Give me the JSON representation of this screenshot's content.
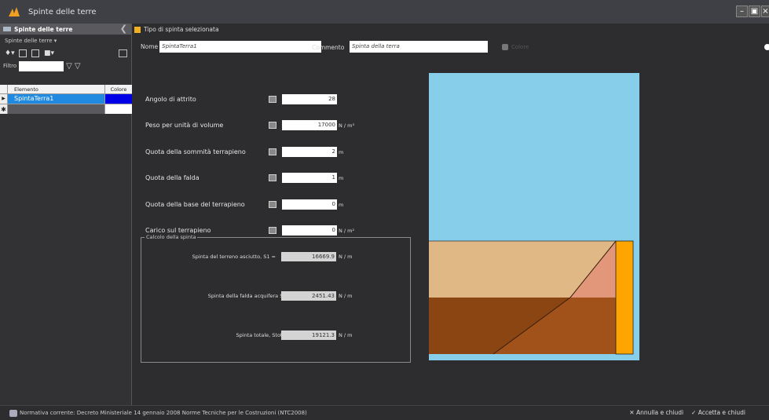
{
  "window": {
    "title": "Spinte delle terre"
  },
  "left_panel": {
    "header": "Spinte delle terre",
    "menu_label": "Spinte delle terre ▾",
    "filter_label": "Filtro",
    "grid": {
      "columns": [
        "Elemento",
        "Colore"
      ],
      "rows": [
        {
          "selected_marker": "▶",
          "elemento": "SpintaTerra1",
          "colore": "#0000e6"
        }
      ],
      "new_row_marker": "✱"
    }
  },
  "main": {
    "title": "Tipo di spinta selezionata",
    "nome_label": "Nome",
    "nome_value": "SpintaTerra1",
    "commento_label": "Commento",
    "commento_value": "Spinta della terra",
    "colore_label": "Colore",
    "params": [
      {
        "label": "Angolo di attrito",
        "value": "28",
        "unit": ""
      },
      {
        "label": "Peso per unità di volume",
        "value": "17000",
        "unit": "N / m³"
      },
      {
        "label": "Quota della sommità terrapieno",
        "value": "2",
        "unit": "m"
      },
      {
        "label": "Quota della falda",
        "value": "1",
        "unit": "m"
      },
      {
        "label": "Quota della base del terrapieno",
        "value": "0",
        "unit": "m"
      },
      {
        "label": "Carico sul terrapieno",
        "value": "0",
        "unit": "N / m²"
      }
    ],
    "calc": {
      "title": "Calcolo della spinta",
      "rows": [
        {
          "label": "Spinta del terreno asciutto, S1 =",
          "value": "16669.9",
          "unit": "N / m"
        },
        {
          "label": "Spinta della falda acquifera S2 =",
          "value": "2451.43",
          "unit": "N / m"
        },
        {
          "label": "Spinta totale, Stot =",
          "value": "19121.3",
          "unit": "N / m"
        }
      ]
    },
    "diagram_colors": {
      "sky": "#87ceeb",
      "soil_dry": "#dfb886",
      "soil_wet": "#8b4513",
      "wedge": "#e2967a",
      "wedge_wet": "#a0521a",
      "wall": "#ffa500"
    }
  },
  "status": {
    "normativa": "Normativa corrente: Decreto Ministeriale 14 gennaio 2008 Norme Tecniche per le Costruzioni (NTC2008)",
    "cancel": "✕ Annulla e chiudi",
    "accept": "✓ Accetta e chiudi"
  }
}
